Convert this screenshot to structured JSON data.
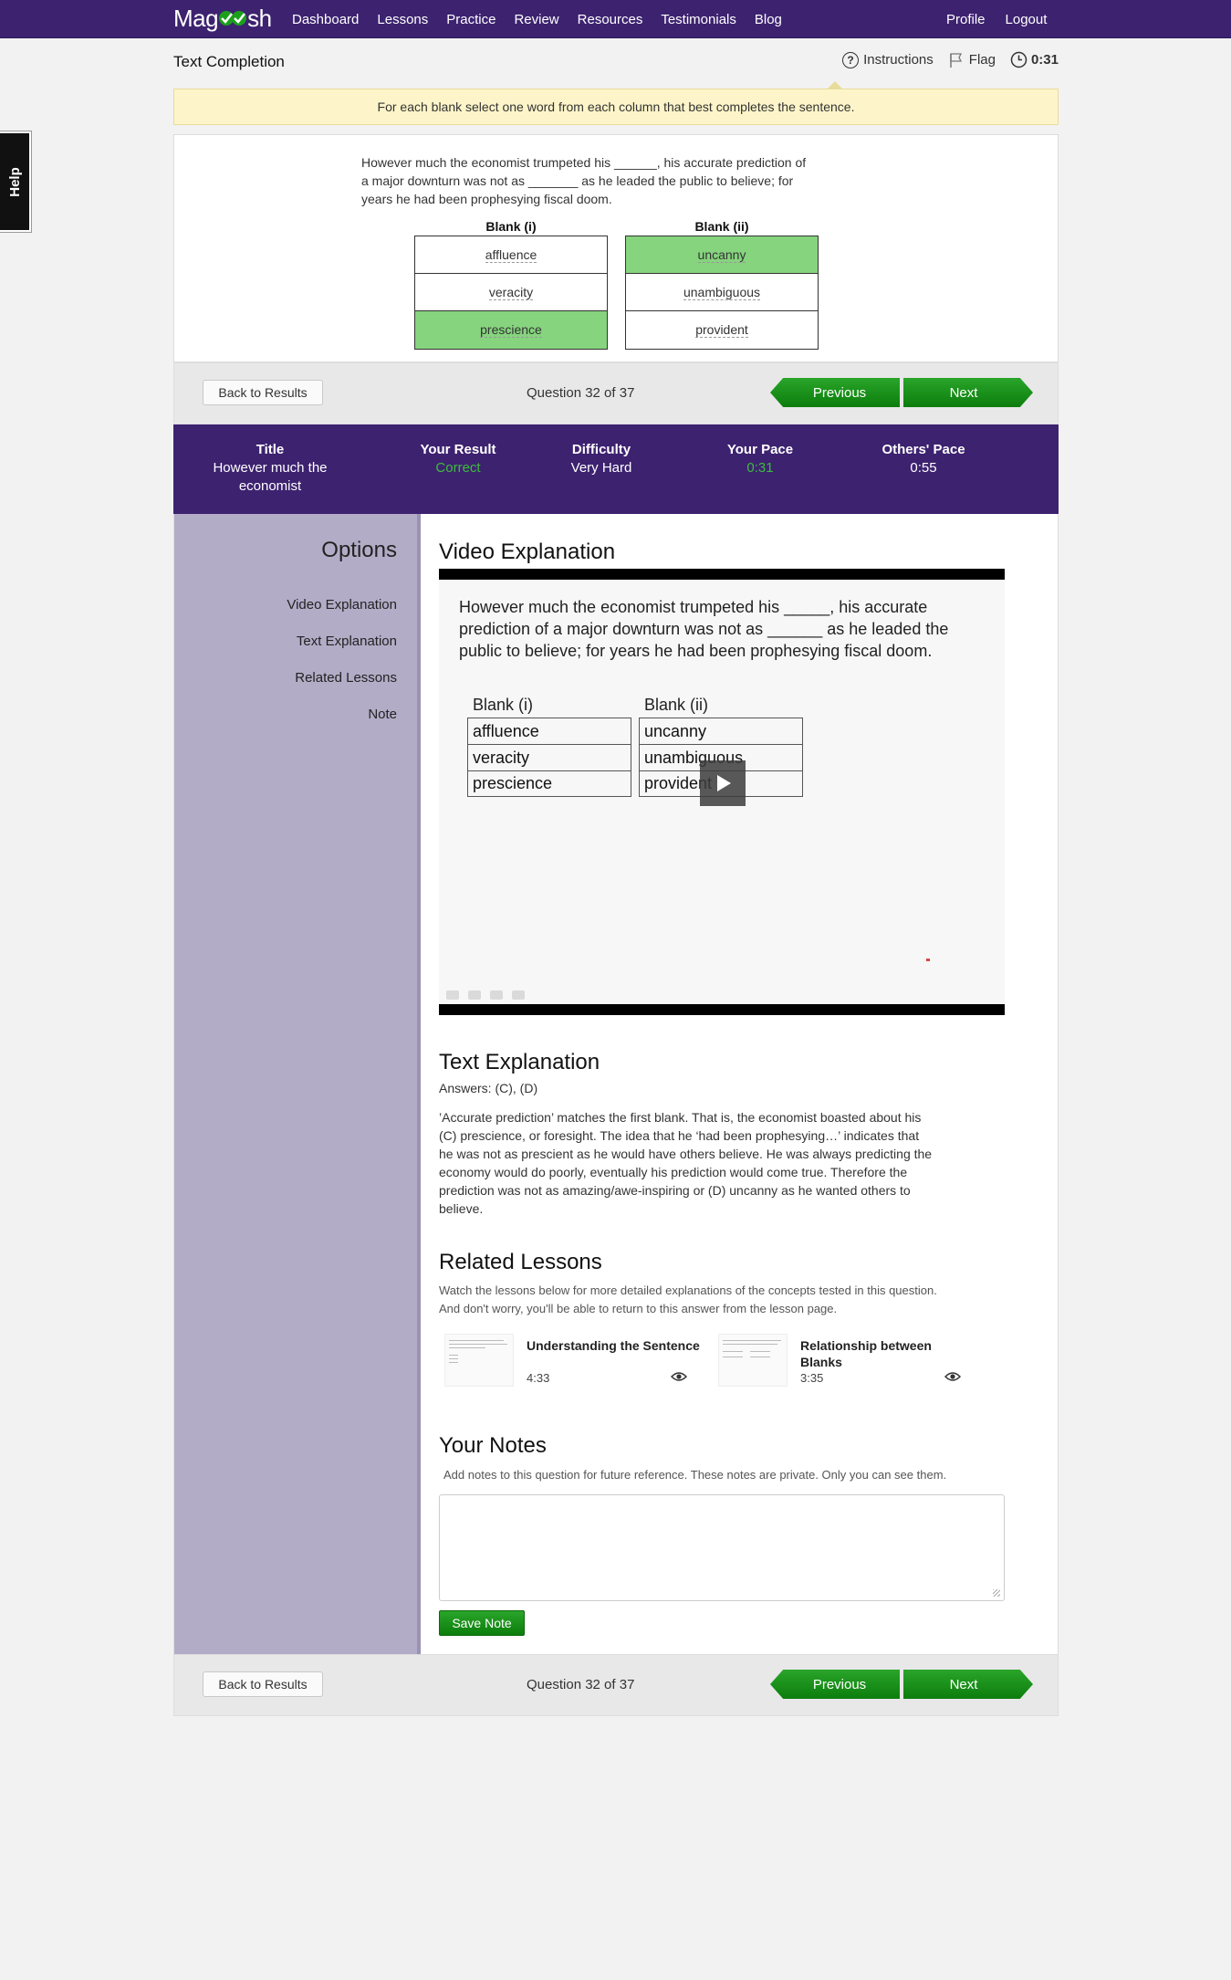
{
  "brand": {
    "logo_left": "Mag",
    "logo_right": "sh",
    "accent": "#3d2270",
    "green": "#1a951a"
  },
  "nav": {
    "items": [
      "Dashboard",
      "Lessons",
      "Practice",
      "Review",
      "Resources",
      "Testimonials",
      "Blog"
    ],
    "right": [
      "Profile",
      "Logout"
    ]
  },
  "help_label": "Help",
  "header": {
    "title": "Text Completion",
    "instructions_label": "Instructions",
    "flag_label": "Flag",
    "timer": "0:31"
  },
  "instructions_text": "For each blank select one word from each column that best completes the sentence.",
  "question": {
    "lines": [
      "However much the economist trumpeted his ______, his accurate prediction of",
      "a major downturn was not as  _______ as he leaded the public to believe; for",
      "years he had been prophesying fiscal doom."
    ],
    "blanks": [
      {
        "label": "Blank (i)",
        "choices": [
          "affluence",
          "veracity",
          "prescience"
        ],
        "selected": 2
      },
      {
        "label": "Blank (ii)",
        "choices": [
          "uncanny",
          "unambiguous",
          "provident"
        ],
        "selected": 0
      }
    ]
  },
  "navigation": {
    "back_label": "Back to Results",
    "counter": "Question 32 of 37",
    "prev_label": "Previous",
    "next_label": "Next"
  },
  "stats": {
    "title_label": "Title",
    "title_value": "However much the economist",
    "result_label": "Your Result",
    "result_value": "Correct",
    "difficulty_label": "Difficulty",
    "difficulty_value": "Very Hard",
    "pace_label": "Your Pace",
    "pace_value": "0:31",
    "others_label": "Others' Pace",
    "others_value": "0:55"
  },
  "options": {
    "title": "Options",
    "items": [
      "Video Explanation",
      "Text Explanation",
      "Related Lessons",
      "Note"
    ]
  },
  "video": {
    "heading": "Video Explanation",
    "lines": [
      "However much the economist trumpeted his _____, his accurate",
      "prediction of a major downturn was not as  ______ as he leaded the",
      "public to believe; for years he had been prophesying fiscal doom."
    ],
    "blank1_label": "Blank (i)",
    "blank1": [
      "affluence",
      "veracity",
      "prescience"
    ],
    "blank2_label": "Blank (ii)",
    "blank2": [
      "uncanny",
      "unambiguous",
      "provident"
    ]
  },
  "text_explanation": {
    "heading": "Text Explanation",
    "answers": "Answers: (C), (D)",
    "lines": [
      "’Accurate prediction’ matches the first blank. That is, the economist boasted about his",
      "(C) prescience, or foresight. The idea that he ‘had been prophesying…’ indicates that",
      "he was not as prescient as he would have others believe. He was always predicting the",
      "economy would do poorly, eventually his prediction would come true. Therefore the",
      "prediction was not as amazing/awe-inspiring or (D) uncanny as he wanted others to",
      "believe."
    ]
  },
  "related": {
    "heading": "Related Lessons",
    "note_lines": [
      "Watch the lessons below for more detailed explanations of the concepts tested in this question.",
      "And don't worry, you'll be able to return to this answer from the lesson page."
    ],
    "lessons": [
      {
        "title": "Understanding the Sentence",
        "time": "4:33"
      },
      {
        "title": "Relationship between Blanks",
        "time": "3:35"
      }
    ]
  },
  "notes": {
    "heading": "Your Notes",
    "subtitle": "Add notes to this question for future reference. These notes are private. Only you can see them.",
    "value": "",
    "save_label": "Save Note"
  }
}
